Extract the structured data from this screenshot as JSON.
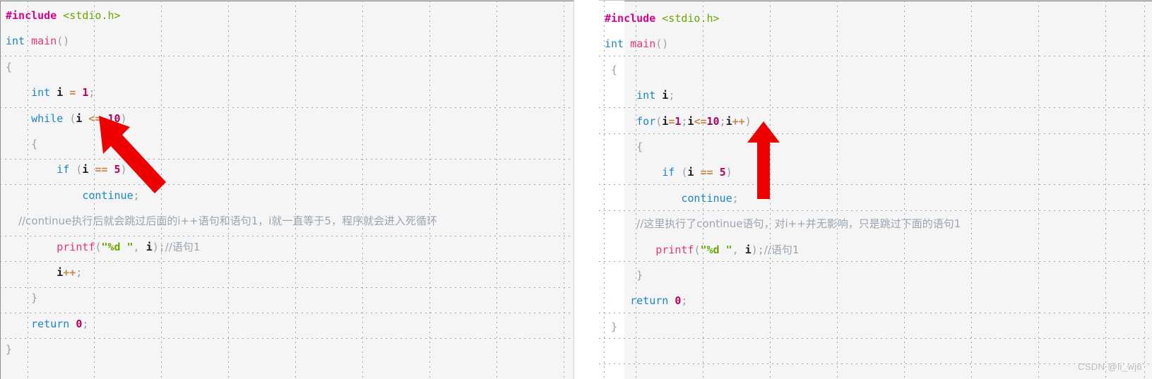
{
  "watermark": "CSDN @li_wj6",
  "colors": {
    "background": "#ffffff",
    "editor_background": "#f5f5f5",
    "grid_dot": "#9aa3ad",
    "arrow": "#ee0000",
    "preprocessor": "#d4048f",
    "header": "#6aa800",
    "keyword": "#1a86c8",
    "function": "#e8356d",
    "number": "#b3005e",
    "operator": "#c58b4a",
    "string": "#6aa800",
    "comment": "#9aa5b1",
    "punctuation": "#9aa0a6",
    "variable": "#1d1d1d",
    "watermark_text": "#b9bdc2"
  },
  "left_panel": {
    "name": "while-loop-example",
    "lines": [
      "#include <stdio.h>",
      "int main()",
      "{",
      "    int i = 1;",
      "    while (i <= 10)",
      "    {",
      "        if (i == 5)",
      "            continue;",
      "  //continue执行后就会跳过后面的i++语句和语句1，i就一直等于5，程序就会进入死循环",
      "        printf(\"%d \", i);//语句1",
      "        i++;",
      "    }",
      "    return 0;",
      "}"
    ],
    "comment_full": "//continue执行后就会跳过后面的i++语句和语句1，i就一直等于5，程序就会进入死循环",
    "statement_comment": "//语句1",
    "arrow": {
      "name": "arrow-pointing-to-while-condition",
      "direction": "up-left",
      "target": "i <= 10"
    }
  },
  "right_panel": {
    "name": "for-loop-example",
    "lines": [
      "#include <stdio.h>",
      "int main()",
      "{",
      "    int i;",
      "    for(i=1;i<=10;i++)",
      "    {",
      "        if (i == 5)",
      "            continue;",
      "    //这里执行了continue语句，对i++并无影响，只是跳过下面的语句1",
      "        printf(\"%d \", i);//语句1",
      "    }",
      "    return 0;",
      "}"
    ],
    "comment_full": "//这里执行了continue语句，对i++并无影响，只是跳过下面的语句1",
    "statement_comment": "//语句1",
    "arrow": {
      "name": "arrow-pointing-to-for-increment",
      "direction": "up",
      "target": "i++"
    }
  },
  "tokens": {
    "include": "#include",
    "stdio": "<stdio.h>",
    "int": "int",
    "main": "main",
    "paren_open": "(",
    "paren_close": ")",
    "brace_open": "{",
    "brace_close": "}",
    "i": "i",
    "assign": "=",
    "one": "1",
    "semi": ";",
    "while": "while",
    "le": "<=",
    "ten": "10",
    "if": "if",
    "eq": "==",
    "five": "5",
    "continue": "continue",
    "printf": "printf",
    "fmt": "\"%d \"",
    "comma": ",",
    "inc": "++",
    "for": "for",
    "return": "return",
    "zero": "0"
  }
}
